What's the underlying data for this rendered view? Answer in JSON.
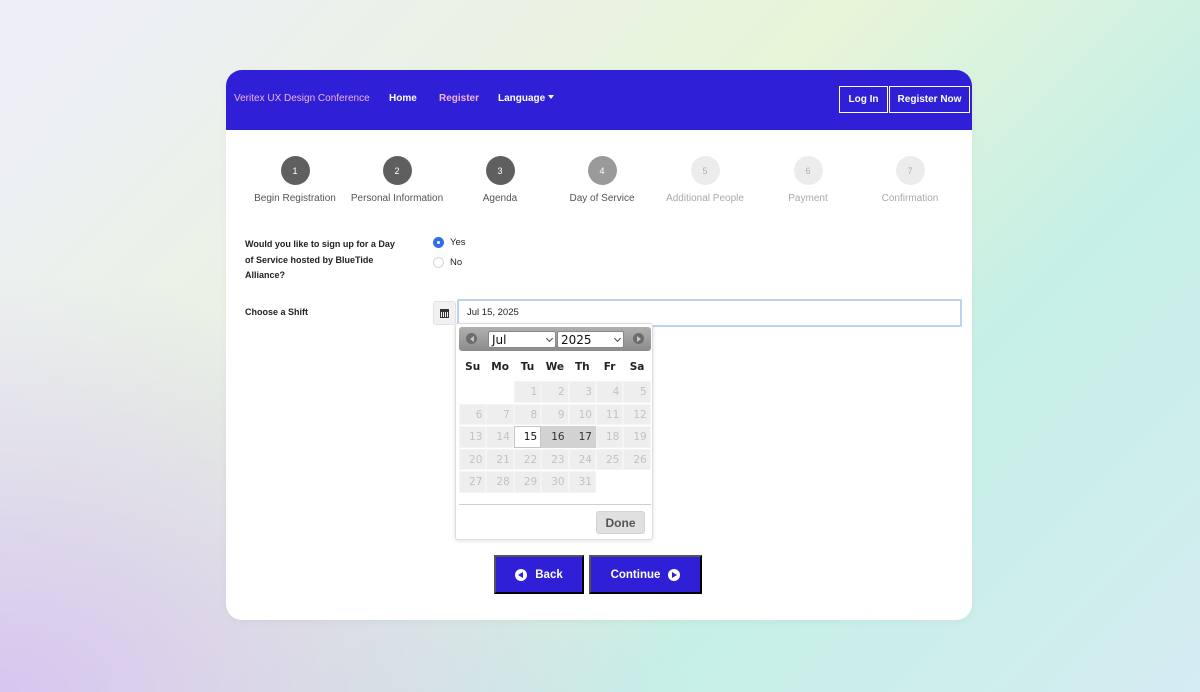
{
  "header": {
    "brand": "Veritex UX Design Conference",
    "nav": {
      "home": "Home",
      "register": "Register",
      "language": "Language"
    },
    "login_label": "Log In",
    "register_now_label": "Register Now"
  },
  "colors": {
    "primary": "#2f1fd6",
    "accent_pink": "#f0b6e0",
    "radio_blue": "#2f6fe6"
  },
  "steps": [
    {
      "number": "1",
      "label": "Begin Registration",
      "state": "done"
    },
    {
      "number": "2",
      "label": "Personal Information",
      "state": "done"
    },
    {
      "number": "3",
      "label": "Agenda",
      "state": "done"
    },
    {
      "number": "4",
      "label": "Day of Service",
      "state": "current"
    },
    {
      "number": "5",
      "label": "Additional People",
      "state": "todo"
    },
    {
      "number": "6",
      "label": "Payment",
      "state": "todo"
    },
    {
      "number": "7",
      "label": "Confirmation",
      "state": "todo"
    }
  ],
  "form": {
    "question": "Would you like to sign up for a Day of Service hosted by BlueTide Alliance?",
    "options": {
      "yes": "Yes",
      "no": "No"
    },
    "selected": "yes",
    "shift_label": "Choose a Shift",
    "shift_value": "Jul 15, 2025"
  },
  "datepicker": {
    "month": "Jul",
    "year": "2025",
    "days_of_week": [
      "Su",
      "Mo",
      "Tu",
      "We",
      "Th",
      "Fr",
      "Sa"
    ],
    "weeks": [
      [
        "",
        "",
        "1",
        "2",
        "3",
        "4",
        "5"
      ],
      [
        "6",
        "7",
        "8",
        "9",
        "10",
        "11",
        "12"
      ],
      [
        "13",
        "14",
        "15",
        "16",
        "17",
        "18",
        "19"
      ],
      [
        "20",
        "21",
        "22",
        "23",
        "24",
        "25",
        "26"
      ],
      [
        "27",
        "28",
        "29",
        "30",
        "31",
        "",
        ""
      ]
    ],
    "selected_day": "15",
    "available_days": [
      "16",
      "17"
    ],
    "done_label": "Done"
  },
  "actions": {
    "back_label": "Back",
    "continue_label": "Continue"
  },
  "icons": {
    "calendar": "calendar-icon",
    "prev": "prev-month-icon",
    "next": "next-month-icon",
    "back": "arrow-circle-left-icon",
    "continue": "arrow-circle-right-icon"
  }
}
